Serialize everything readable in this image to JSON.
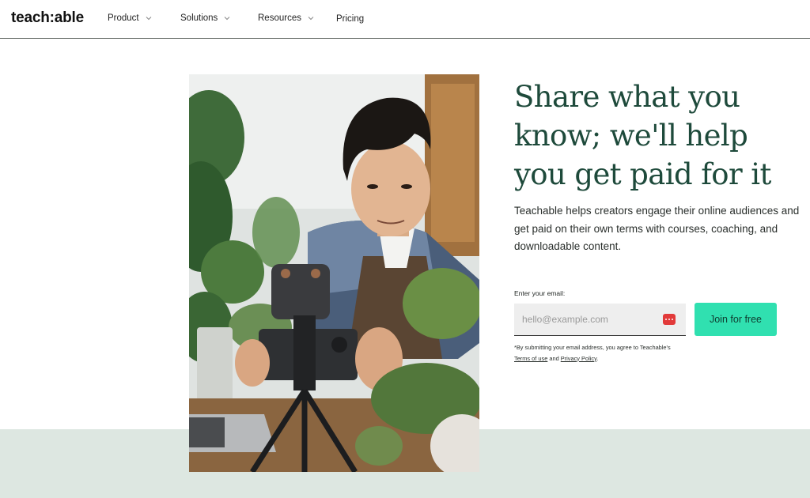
{
  "nav": {
    "logo": "teach:able",
    "items": [
      {
        "label": "Product"
      },
      {
        "label": "Solutions"
      },
      {
        "label": "Resources"
      },
      {
        "label": "Pricing"
      }
    ]
  },
  "hero": {
    "title": "Share what you know; we'll help you get paid for it",
    "description": "Teachable helps creators engage their online audiences and get paid on their own terms with courses, coaching, and downloadable content.",
    "email_label": "Enter your email:",
    "email_placeholder": "hello@example.com",
    "email_value": "",
    "join_label": "Join for free",
    "disclaimer_prefix": "*By submitting your email address, you agree to Teachable's ",
    "terms_link": "Terms of use",
    "disclaimer_and": " and ",
    "privacy_link": "Privacy Policy",
    "disclaimer_suffix": "."
  },
  "colors": {
    "accent_button": "#30e0b0",
    "title_green": "#1e4a3b",
    "band_bg": "#dde7e1",
    "autofill_icon": "#e23a3a"
  },
  "icons": {
    "chevron": "chevron-down-icon",
    "autofill": "password-manager-icon"
  }
}
